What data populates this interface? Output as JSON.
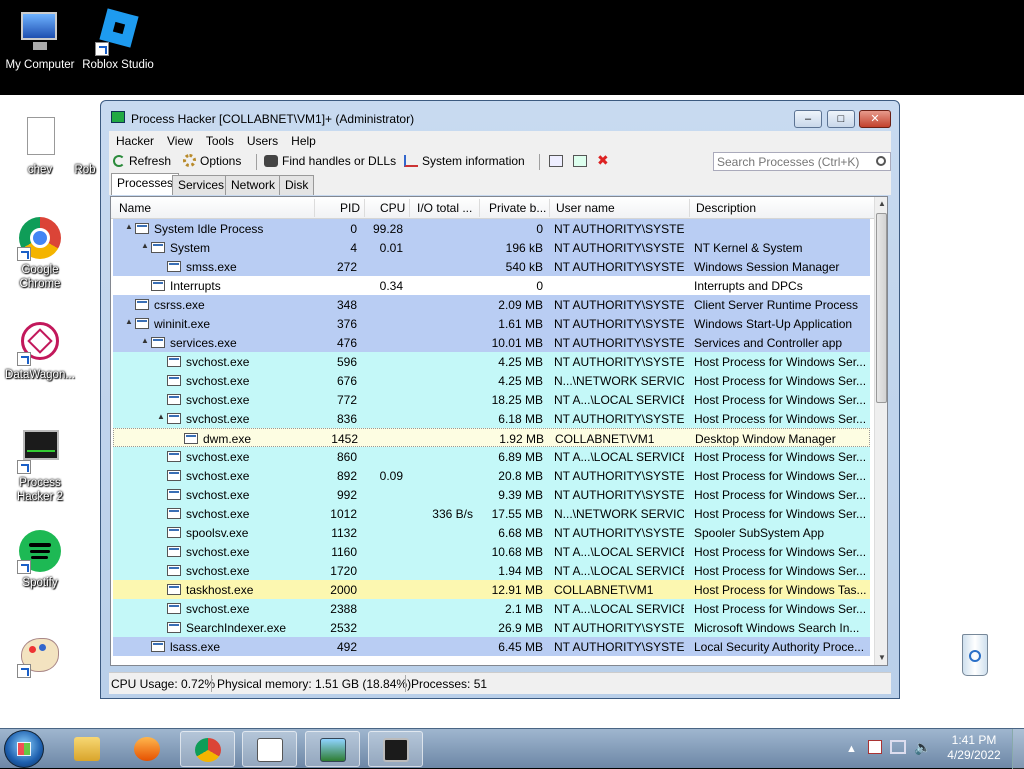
{
  "desktop": {
    "icons": [
      {
        "label": "My Computer"
      },
      {
        "label": "Roblox Studio"
      },
      {
        "label": "chev"
      },
      {
        "label": "Rob"
      },
      {
        "label": "Google Chrome"
      },
      {
        "label": "DataWagon..."
      },
      {
        "label": "Process Hacker 2"
      },
      {
        "label": "Spotify"
      },
      {
        "label": "Paint"
      },
      {
        "label": "Recycle Bin"
      }
    ]
  },
  "window": {
    "title": "Process Hacker [COLLABNET\\VM1]+ (Administrator)",
    "controls": {
      "min": "–",
      "max": "□",
      "close": "✕"
    }
  },
  "menu": [
    "Hacker",
    "View",
    "Tools",
    "Users",
    "Help"
  ],
  "toolbar": {
    "refresh": "Refresh",
    "options": "Options",
    "find": "Find handles or DLLs",
    "sysinfo": "System information",
    "search_placeholder": "Search Processes (Ctrl+K)"
  },
  "tabs": [
    "Processes",
    "Services",
    "Network",
    "Disk"
  ],
  "columns": [
    "Name",
    "PID",
    "CPU",
    "I/O total ...",
    "Private b...",
    "User name",
    "Description"
  ],
  "processes": [
    {
      "name": "System Idle Process",
      "pid": "0",
      "cpu": "99.28",
      "io": "",
      "priv": "0",
      "user": "NT AUTHORITY\\SYSTEM",
      "desc": "",
      "level": 0,
      "tree": "▲",
      "type": "system"
    },
    {
      "name": "System",
      "pid": "4",
      "cpu": "0.01",
      "io": "",
      "priv": "196 kB",
      "user": "NT AUTHORITY\\SYSTEM",
      "desc": "NT Kernel & System",
      "level": 1,
      "tree": "▲",
      "type": "system"
    },
    {
      "name": "smss.exe",
      "pid": "272",
      "cpu": "",
      "io": "",
      "priv": "540 kB",
      "user": "NT AUTHORITY\\SYSTEM",
      "desc": "Windows Session Manager",
      "level": 2,
      "tree": "",
      "type": "system"
    },
    {
      "name": "Interrupts",
      "pid": "",
      "cpu": "0.34",
      "io": "",
      "priv": "0",
      "user": "",
      "desc": "Interrupts and DPCs",
      "level": 1,
      "tree": "",
      "type": "plain"
    },
    {
      "name": "csrss.exe",
      "pid": "348",
      "cpu": "",
      "io": "",
      "priv": "2.09 MB",
      "user": "NT AUTHORITY\\SYSTEM",
      "desc": "Client Server Runtime Process",
      "level": 0,
      "tree": "",
      "type": "system"
    },
    {
      "name": "wininit.exe",
      "pid": "376",
      "cpu": "",
      "io": "",
      "priv": "1.61 MB",
      "user": "NT AUTHORITY\\SYSTEM",
      "desc": "Windows Start-Up Application",
      "level": 0,
      "tree": "▲",
      "type": "system"
    },
    {
      "name": "services.exe",
      "pid": "476",
      "cpu": "",
      "io": "",
      "priv": "10.01 MB",
      "user": "NT AUTHORITY\\SYSTEM",
      "desc": "Services and Controller app",
      "level": 1,
      "tree": "▲",
      "type": "system"
    },
    {
      "name": "svchost.exe",
      "pid": "596",
      "cpu": "",
      "io": "",
      "priv": "4.25 MB",
      "user": "NT AUTHORITY\\SYSTEM",
      "desc": "Host Process for Windows Ser...",
      "level": 2,
      "tree": "",
      "type": "service"
    },
    {
      "name": "svchost.exe",
      "pid": "676",
      "cpu": "",
      "io": "",
      "priv": "4.25 MB",
      "user": "N...\\NETWORK SERVICE",
      "desc": "Host Process for Windows Ser...",
      "level": 2,
      "tree": "",
      "type": "service"
    },
    {
      "name": "svchost.exe",
      "pid": "772",
      "cpu": "",
      "io": "",
      "priv": "18.25 MB",
      "user": "NT A...\\LOCAL SERVICE",
      "desc": "Host Process for Windows Ser...",
      "level": 2,
      "tree": "",
      "type": "service"
    },
    {
      "name": "svchost.exe",
      "pid": "836",
      "cpu": "",
      "io": "",
      "priv": "6.18 MB",
      "user": "NT AUTHORITY\\SYSTEM",
      "desc": "Host Process for Windows Ser...",
      "level": 2,
      "tree": "▲",
      "type": "service"
    },
    {
      "name": "dwm.exe",
      "pid": "1452",
      "cpu": "",
      "io": "",
      "priv": "1.92 MB",
      "user": "COLLABNET\\VM1",
      "desc": "Desktop Window Manager",
      "level": 3,
      "tree": "",
      "type": "selected"
    },
    {
      "name": "svchost.exe",
      "pid": "860",
      "cpu": "",
      "io": "",
      "priv": "6.89 MB",
      "user": "NT A...\\LOCAL SERVICE",
      "desc": "Host Process for Windows Ser...",
      "level": 2,
      "tree": "",
      "type": "service"
    },
    {
      "name": "svchost.exe",
      "pid": "892",
      "cpu": "0.09",
      "io": "",
      "priv": "20.8 MB",
      "user": "NT AUTHORITY\\SYSTEM",
      "desc": "Host Process for Windows Ser...",
      "level": 2,
      "tree": "",
      "type": "service"
    },
    {
      "name": "svchost.exe",
      "pid": "992",
      "cpu": "",
      "io": "",
      "priv": "9.39 MB",
      "user": "NT AUTHORITY\\SYSTEM",
      "desc": "Host Process for Windows Ser...",
      "level": 2,
      "tree": "",
      "type": "service"
    },
    {
      "name": "svchost.exe",
      "pid": "1012",
      "cpu": "",
      "io": "336 B/s",
      "priv": "17.55 MB",
      "user": "N...\\NETWORK SERVICE",
      "desc": "Host Process for Windows Ser...",
      "level": 2,
      "tree": "",
      "type": "service"
    },
    {
      "name": "spoolsv.exe",
      "pid": "1132",
      "cpu": "",
      "io": "",
      "priv": "6.68 MB",
      "user": "NT AUTHORITY\\SYSTEM",
      "desc": "Spooler SubSystem App",
      "level": 2,
      "tree": "",
      "type": "service"
    },
    {
      "name": "svchost.exe",
      "pid": "1160",
      "cpu": "",
      "io": "",
      "priv": "10.68 MB",
      "user": "NT A...\\LOCAL SERVICE",
      "desc": "Host Process for Windows Ser...",
      "level": 2,
      "tree": "",
      "type": "service"
    },
    {
      "name": "svchost.exe",
      "pid": "1720",
      "cpu": "",
      "io": "",
      "priv": "1.94 MB",
      "user": "NT A...\\LOCAL SERVICE",
      "desc": "Host Process for Windows Ser...",
      "level": 2,
      "tree": "",
      "type": "service"
    },
    {
      "name": "taskhost.exe",
      "pid": "2000",
      "cpu": "",
      "io": "",
      "priv": "12.91 MB",
      "user": "COLLABNET\\VM1",
      "desc": "Host Process for Windows Tas...",
      "level": 2,
      "tree": "",
      "type": "own"
    },
    {
      "name": "svchost.exe",
      "pid": "2388",
      "cpu": "",
      "io": "",
      "priv": "2.1 MB",
      "user": "NT A...\\LOCAL SERVICE",
      "desc": "Host Process for Windows Ser...",
      "level": 2,
      "tree": "",
      "type": "service"
    },
    {
      "name": "SearchIndexer.exe",
      "pid": "2532",
      "cpu": "",
      "io": "",
      "priv": "26.9 MB",
      "user": "NT AUTHORITY\\SYSTEM",
      "desc": "Microsoft Windows Search In...",
      "level": 2,
      "tree": "",
      "type": "service"
    },
    {
      "name": "lsass.exe",
      "pid": "492",
      "cpu": "",
      "io": "",
      "priv": "6.45 MB",
      "user": "NT AUTHORITY\\SYSTEM",
      "desc": "Local Security Authority Proce...",
      "level": 1,
      "tree": "",
      "type": "system"
    }
  ],
  "status": {
    "cpu": "CPU Usage: 0.72%",
    "memory": "Physical memory: 1.51 GB (18.84%)",
    "processes": "Processes: 51"
  },
  "taskbar": {
    "time": "1:41 PM",
    "date": "4/29/2022"
  },
  "colors": {
    "system": "#b9cdf3",
    "service": "#c4f8f8",
    "own": "#fcf7b0",
    "desktop_top": "#000000"
  }
}
